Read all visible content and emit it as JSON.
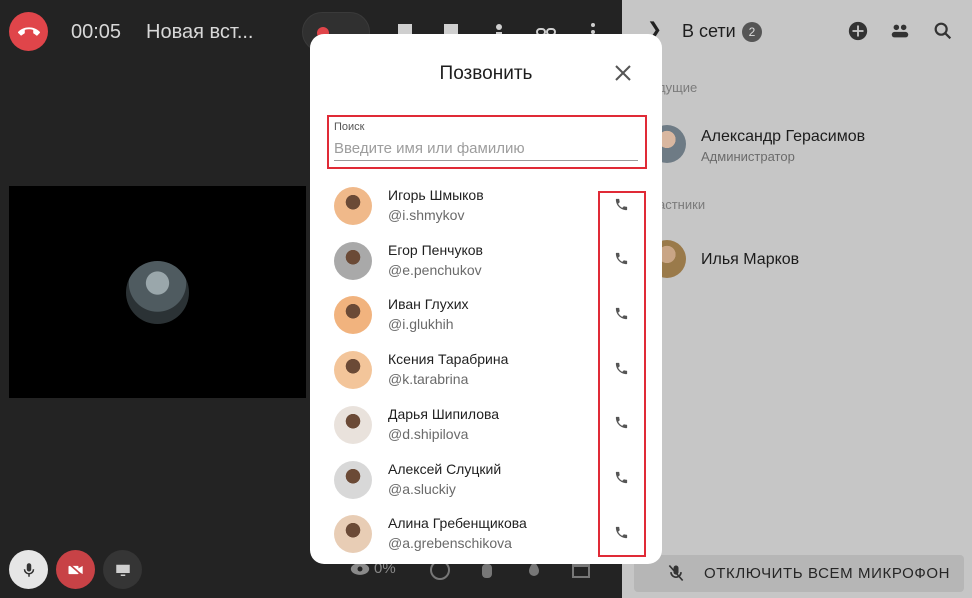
{
  "header": {
    "timer": "00:05",
    "title": "Новая вст..."
  },
  "bottom": {
    "views": "0%"
  },
  "side_panel": {
    "title": "В сети",
    "count": "2",
    "sections": {
      "hosts_label": "дущие",
      "participants_label": "астники"
    },
    "host": {
      "name": "Александр Герасимов",
      "role": "Администратор"
    },
    "participant": {
      "name": "Илья Марков"
    },
    "mute_all_label": "ОТКЛЮЧИТЬ ВСЕМ МИКРОФОН"
  },
  "modal": {
    "title": "Позвонить",
    "search": {
      "label": "Поиск",
      "placeholder": "Введите имя или фамилию",
      "value": ""
    },
    "contacts": [
      {
        "name": "Игорь Шмыков",
        "handle": "@i.shmykov",
        "avatar_bg": "#f0b98a"
      },
      {
        "name": "Егор Пенчуков",
        "handle": "@e.penchukov",
        "avatar_bg": "#a9a9a9"
      },
      {
        "name": "Иван Глухих",
        "handle": "@i.glukhih",
        "avatar_bg": "#f1b37e"
      },
      {
        "name": "Ксения Тарабрина",
        "handle": "@k.tarabrina",
        "avatar_bg": "#f3c59a"
      },
      {
        "name": "Дарья Шипилова",
        "handle": "@d.shipilova",
        "avatar_bg": "#e9e2dc"
      },
      {
        "name": "Алексей Слуцкий",
        "handle": "@a.sluckiy",
        "avatar_bg": "#d8d8d8"
      },
      {
        "name": "Алина Гребенщикова",
        "handle": "@a.grebenschikova",
        "avatar_bg": "#e8cdb5"
      }
    ]
  },
  "colors": {
    "danger": "#e0454a",
    "highlight": "#e02a36",
    "panel_dim": "#c6c6c6"
  }
}
